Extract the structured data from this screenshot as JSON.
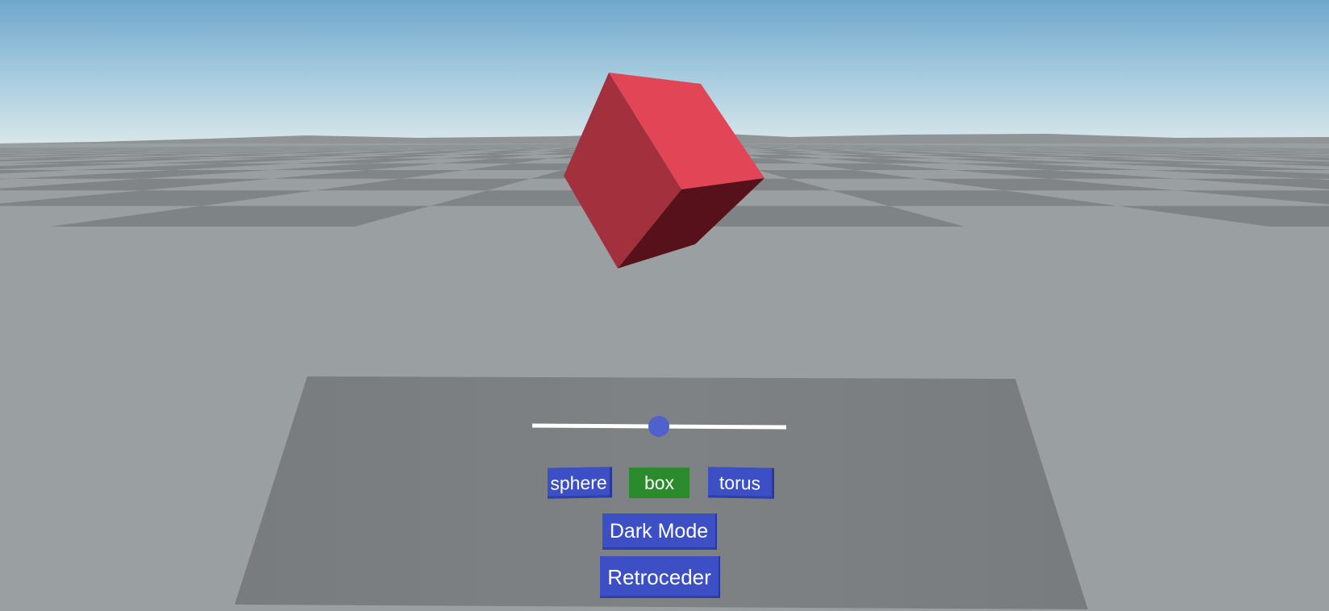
{
  "scene": {
    "sky_top_color": "#6fa7cc",
    "sky_horizon_color": "#d6e4ea",
    "floor_light_color": "#9a9fa2",
    "floor_dark_color": "#7e8386",
    "cube_color": "#e04455",
    "panel_color": "#7b7f81"
  },
  "panel": {
    "slider": {
      "value": 0.5,
      "track_color": "#ffffff",
      "thumb_color": "#4e61cc"
    },
    "shape_buttons": [
      {
        "label": "sphere",
        "active": false
      },
      {
        "label": "box",
        "active": true
      },
      {
        "label": "torus",
        "active": false
      }
    ],
    "dark_mode_label": "Dark Mode",
    "back_label": "Retroceder",
    "button_color": "#3c4fc4",
    "active_button_color": "#2b8a2b"
  }
}
